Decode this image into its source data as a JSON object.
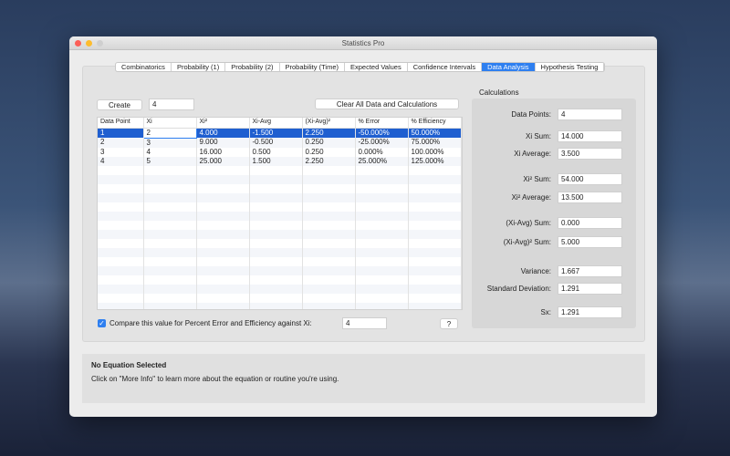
{
  "window": {
    "title": "Statistics Pro"
  },
  "tabs": [
    {
      "label": "Combinatorics"
    },
    {
      "label": "Probability (1)"
    },
    {
      "label": "Probability (2)"
    },
    {
      "label": "Probability (Time)"
    },
    {
      "label": "Expected Values"
    },
    {
      "label": "Confidence Intervals"
    },
    {
      "label": "Data Analysis",
      "selected": true
    },
    {
      "label": "Hypothesis Testing"
    }
  ],
  "controls": {
    "create_label": "Create",
    "count_value": "4",
    "clear_label": "Clear All Data and Calculations"
  },
  "table": {
    "headers": [
      "Data Point",
      "Xi",
      "Xi²",
      "Xi-Avg",
      "(Xi-Avg)²",
      "% Error",
      "% Efficiency"
    ],
    "rows": [
      [
        "1",
        "2",
        "4.000",
        "-1.500",
        "2.250",
        "-50.000%",
        "50.000%"
      ],
      [
        "2",
        "3",
        "9.000",
        "-0.500",
        "0.250",
        "-25.000%",
        "75.000%"
      ],
      [
        "3",
        "4",
        "16.000",
        "0.500",
        "0.250",
        "0.000%",
        "100.000%"
      ],
      [
        "4",
        "5",
        "25.000",
        "1.500",
        "2.250",
        "25.000%",
        "125.000%"
      ]
    ],
    "selected_row": 0
  },
  "compare": {
    "checked": true,
    "label": "Compare this value for Percent Error and Efficiency against Xi:",
    "value": "4",
    "help_label": "?"
  },
  "calculations": {
    "title": "Calculations",
    "items": [
      {
        "label": "Data Points:",
        "value": "4"
      },
      {
        "label": "Xi Sum:",
        "value": "14.000"
      },
      {
        "label": "Xi Average:",
        "value": "3.500"
      },
      {
        "label": "Xi² Sum:",
        "value": "54.000"
      },
      {
        "label": "Xi² Average:",
        "value": "13.500"
      },
      {
        "label": "(Xi-Avg) Sum:",
        "value": "0.000"
      },
      {
        "label": "(Xi-Avg)² Sum:",
        "value": "5.000"
      },
      {
        "label": "Variance:",
        "value": "1.667"
      },
      {
        "label": "Standard Deviation:",
        "value": "1.291"
      },
      {
        "label": "Sx:",
        "value": "1.291"
      }
    ]
  },
  "info": {
    "title": "No Equation Selected",
    "text": "Click on \"More Info\" to learn more about the equation or routine you're using."
  },
  "colors": {
    "accent": "#2e7ff0",
    "selection": "#1f5fd0"
  }
}
